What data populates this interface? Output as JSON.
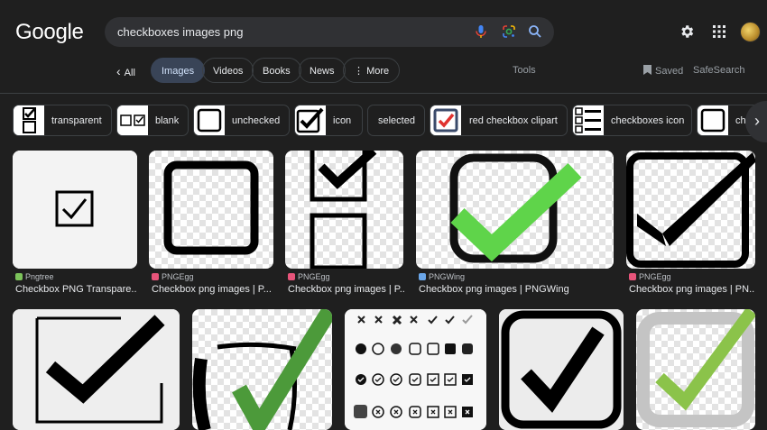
{
  "header": {
    "logo": "Google",
    "query": "checkboxes images png"
  },
  "nav": {
    "back_label": "‹",
    "all": "All",
    "images": "Images",
    "videos": "Videos",
    "books": "Books",
    "news": "News",
    "more": "More",
    "tools": "Tools",
    "saved": "Saved",
    "safesearch": "SafeSearch"
  },
  "chips": [
    "transparent",
    "blank",
    "unchecked",
    "icon",
    "selected",
    "red checkbox clipart",
    "checkboxes icon",
    "ch"
  ],
  "results_row1": [
    {
      "source": "Pngtree",
      "caption": "Checkbox PNG Transpare...",
      "fav_color": "#7cc35b"
    },
    {
      "source": "PNGEgg",
      "caption": "Checkbox png images | P...",
      "fav_color": "#e7547a"
    },
    {
      "source": "PNGEgg",
      "caption": "Checkbox png images | P...",
      "fav_color": "#e7547a"
    },
    {
      "source": "PNGWing",
      "caption": "Checkbox png images | PNGWing",
      "fav_color": "#6aa6e8"
    },
    {
      "source": "PNGEgg",
      "caption": "Checkbox png images | PN...",
      "fav_color": "#e7547a"
    }
  ],
  "colors": {
    "background": "#1f1f1f",
    "searchbox": "#303134",
    "active_tab": "#394457",
    "green_check": "#5fd44a"
  },
  "icons": [
    "microphone-icon",
    "lens-icon",
    "search-icon",
    "settings-icon",
    "apps-grid-icon",
    "bookmark-icon",
    "chevron-right-icon"
  ]
}
